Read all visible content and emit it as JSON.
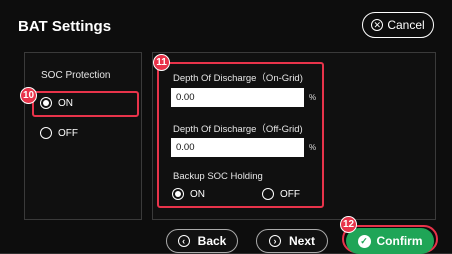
{
  "header": {
    "title": "BAT Settings",
    "cancel_label": "Cancel"
  },
  "soc_protection": {
    "label": "SOC Protection",
    "options": [
      {
        "label": "ON",
        "selected": true
      },
      {
        "label": "OFF",
        "selected": false
      }
    ],
    "annotation": "10"
  },
  "discharge": {
    "annotation": "11",
    "on_grid": {
      "label": "Depth Of Discharge（On-Grid)",
      "value": "0.00",
      "unit": "%"
    },
    "off_grid": {
      "label": "Depth Of Discharge（Off-Grid)",
      "value": "0.00",
      "unit": "%"
    },
    "backup": {
      "label": "Backup SOC Holding",
      "options": [
        {
          "label": "ON",
          "selected": true
        },
        {
          "label": "OFF",
          "selected": false
        }
      ]
    }
  },
  "footer": {
    "back_label": "Back",
    "next_label": "Next",
    "confirm_label": "Confirm",
    "annotation": "12"
  },
  "colors": {
    "accent_red": "#e8334a",
    "confirm_green": "#1fa557"
  }
}
